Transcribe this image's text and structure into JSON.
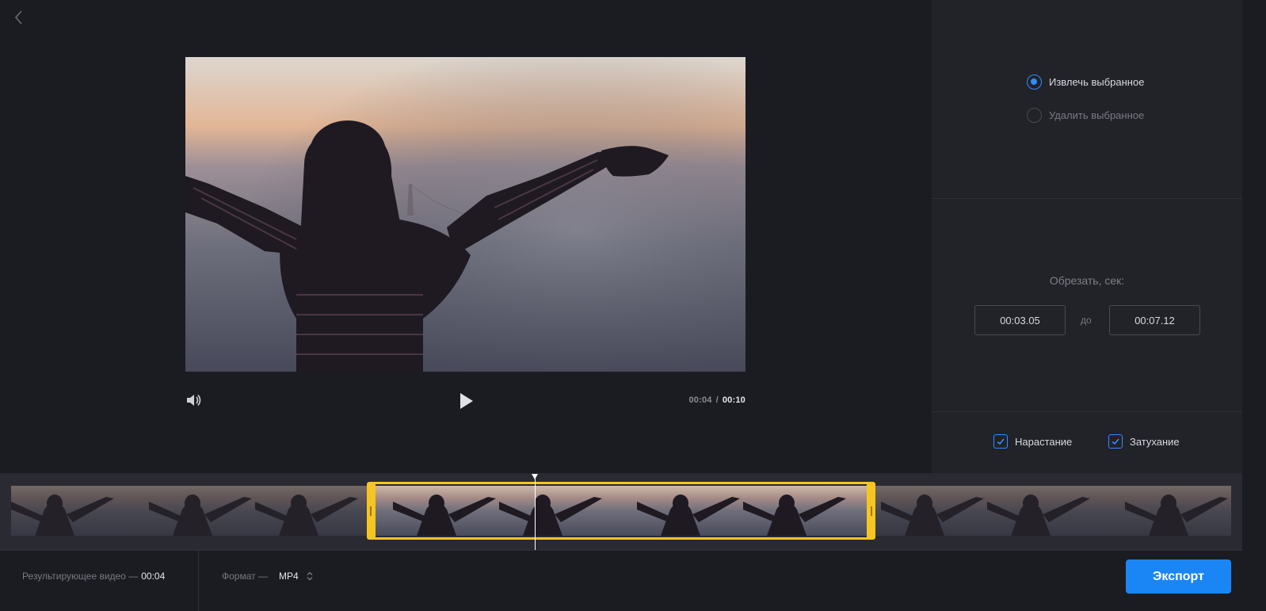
{
  "editor": {
    "back_icon": "chevron-left-icon",
    "video": {
      "scene": "woman-silhouette-above-clouds"
    },
    "controls": {
      "volume_icon": "volume-icon",
      "play_icon": "play-icon",
      "current_time": "00:04",
      "separator": "/",
      "total_time": "00:10"
    }
  },
  "panel": {
    "mode": {
      "options": [
        {
          "label": "Извлечь выбранное",
          "selected": true
        },
        {
          "label": "Удалить выбранное",
          "selected": false
        }
      ]
    },
    "trim": {
      "title": "Обрезать, сек:",
      "start": "00:03.05",
      "to_label": "до",
      "end": "00:07.12"
    },
    "effects": {
      "fade_in": {
        "label": "Нарастание",
        "checked": true
      },
      "fade_out": {
        "label": "Затухание",
        "checked": true
      }
    }
  },
  "timeline": {
    "thumbnail_count": 10,
    "selection_start_fraction": 0.31,
    "selection_end_fraction": 0.71,
    "playhead_fraction": 0.4
  },
  "bottombar": {
    "result_label": "Результирующее видео —",
    "result_value": "00:04",
    "format_label": "Формат —",
    "format_value": "MP4",
    "export_label": "Экспорт"
  },
  "colors": {
    "accent": "#1a86f5",
    "selection": "#f7c520",
    "background": "#1b1b22",
    "panel": "#222229"
  }
}
